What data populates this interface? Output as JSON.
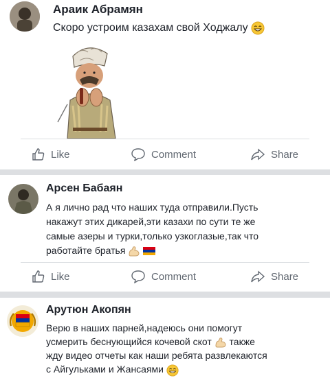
{
  "posts": [
    {
      "author": "Араик Абрамян",
      "lines": [
        "Скоро устроим казахам свой Ходжалу"
      ],
      "emoji": "grin-emoji"
    },
    {
      "author": "Арсен Бабаян",
      "lines": [
        "А я лично рад что наших туда отправили.Пусть",
        "накажут этих дикарей,эти казахи по сути те же",
        "самые азеры и турки,только узкоглазые,так что",
        "работайте братья"
      ]
    },
    {
      "author": "Арутюн Акопян",
      "lines": [
        "Верю в наших парней,надеюсь они помогут",
        "усмерить беснующийся кочевой скот",
        "жду видео отчеты как наши ребята развлекаются",
        "с Айгульками и Жансаями"
      ],
      "line2_tail": "также"
    }
  ],
  "actions": {
    "like": "Like",
    "comment": "Comment",
    "share": "Share"
  },
  "colors": {
    "separator": "#dddfe2",
    "action_text": "#606770",
    "flag_red": "#d90012",
    "flag_blue": "#0033a0",
    "flag_orange": "#f2a800"
  }
}
